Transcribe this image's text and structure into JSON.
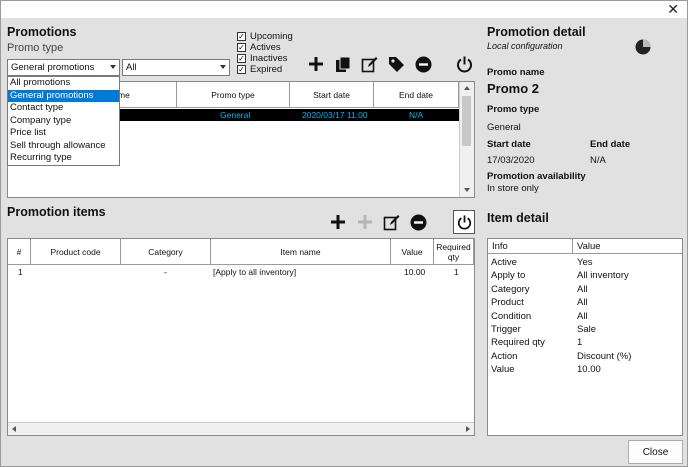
{
  "window": {
    "close_glyph": "✕"
  },
  "promotions": {
    "title": "Promotions",
    "promo_type_label": "Promo type",
    "type_combo_value": "General promotions",
    "status_combo_value": "All",
    "filters": [
      {
        "label": "Upcoming",
        "checked": true
      },
      {
        "label": "Actives",
        "checked": true
      },
      {
        "label": "Inactives",
        "checked": true
      },
      {
        "label": "Expired",
        "checked": true
      }
    ],
    "dropdown_options": [
      {
        "label": "All promotions",
        "selected": false
      },
      {
        "label": "General promotions",
        "selected": true
      },
      {
        "label": "Contact type",
        "selected": false
      },
      {
        "label": "Company type",
        "selected": false
      },
      {
        "label": "Price list",
        "selected": false
      },
      {
        "label": "Sell through allowance",
        "selected": false
      },
      {
        "label": "Recurring type",
        "selected": false
      }
    ],
    "columns": {
      "name_partial": "me",
      "promo_type": "Promo type",
      "start_date": "Start date",
      "end_date": "End date"
    },
    "rows": [
      {
        "promo_type": "General",
        "start_date": "2020/03/17 11:00",
        "end_date": "N/A"
      }
    ],
    "toolbar_icons": [
      "add-icon",
      "copy-icon",
      "edit-icon",
      "tag-icon",
      "remove-icon",
      "power-icon"
    ]
  },
  "promotion_items": {
    "title": "Promotion items",
    "columns": {
      "num": "#",
      "product_code": "Product code",
      "category": "Category",
      "item_name": "Item name",
      "value": "Value",
      "required_qty_1": "Required",
      "required_qty_2": "qty"
    },
    "rows": [
      {
        "num": "1",
        "product_code": "",
        "category": "-",
        "item_name": "[Apply to all inventory]",
        "value": "10.00",
        "required_qty": "1"
      }
    ],
    "toolbar_icons": [
      "add-icon",
      "add-disabled-icon",
      "edit-icon",
      "remove-icon",
      "power-icon"
    ]
  },
  "promotion_detail": {
    "title": "Promotion detail",
    "subtitle": "Local configuration",
    "promo_name_label": "Promo name",
    "promo_name_value": "Promo 2",
    "promo_type_label": "Promo type",
    "promo_type_value": "General",
    "start_date_label": "Start date",
    "start_date_value": "17/03/2020",
    "end_date_label": "End date",
    "end_date_value": "N/A",
    "availability_label": "Promotion availability",
    "availability_value": "In store only"
  },
  "item_detail": {
    "title": "Item detail",
    "columns": {
      "info": "Info",
      "value": "Value"
    },
    "rows": [
      {
        "info": "Active",
        "value": "Yes"
      },
      {
        "info": "Apply to",
        "value": "All inventory"
      },
      {
        "info": "Category",
        "value": "All"
      },
      {
        "info": "Product",
        "value": "All"
      },
      {
        "info": "Condition",
        "value": "All"
      },
      {
        "info": "Trigger",
        "value": "Sale"
      },
      {
        "info": "Required qty",
        "value": "1"
      },
      {
        "info": "Action",
        "value": "Discount (%)"
      },
      {
        "info": "Value",
        "value": "10.00"
      }
    ]
  },
  "footer": {
    "close_label": "Close"
  },
  "colors": {
    "accent": "#0078d7",
    "row_selected_bg": "#000000",
    "row_selected_text": "#00b4f0"
  }
}
